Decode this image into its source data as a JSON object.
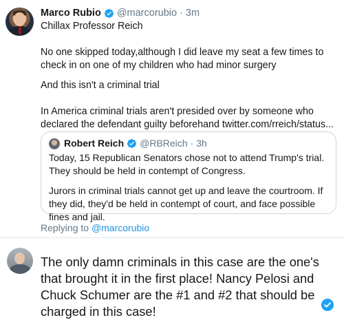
{
  "tweet": {
    "name": "Marco Rubio",
    "handle": "@marcorubio",
    "separator": "·",
    "time": "3m",
    "paragraphs": [
      "Chillax Professor Reich",
      "No one skipped today,although I did leave my seat a few times to check in on one of my children who had minor surgery",
      "And this isn't a criminal trial",
      "In America criminal trials aren't presided over by someone who declared the defendant guilty beforehand twitter.com/rreich/status..."
    ],
    "icons": {
      "verified": "verified-badge-icon",
      "avatar": "profile-avatar"
    },
    "colors": {
      "verified": "#1da1f2",
      "handle": "#657786",
      "link": "#1b95e0"
    }
  },
  "quote": {
    "name": "Robert Reich",
    "handle": "@RBReich",
    "separator": "·",
    "time": "3h",
    "paragraphs": [
      "Today, 15 Republican Senators chose not to attend Trump's trial. They should be held in contempt of Congress.",
      "Jurors in criminal trials cannot get up and leave the courtroom. If they did, they'd be held in contempt of court, and face possible fines and jail."
    ]
  },
  "replying": {
    "prefix": "Replying to ",
    "mention": "@marcorubio"
  },
  "reply": {
    "text": "The only damn criminals in this case are the one's that brought it in the first place! Nancy Pelosi and Chuck Schumer are the #1 and #2 that should be charged in this case!",
    "icon": "check-circle-icon"
  }
}
